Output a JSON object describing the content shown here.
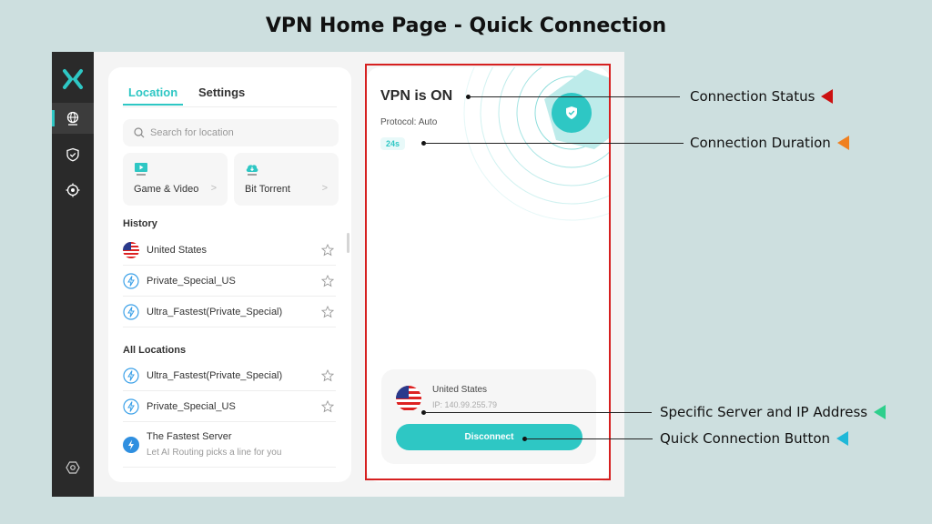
{
  "slide": {
    "title": "VPN Home Page - Quick Connection"
  },
  "rail": {
    "items": [
      {
        "name": "locations",
        "icon": "globe-icon",
        "active": true
      },
      {
        "name": "protection",
        "icon": "shield-check-icon",
        "active": false
      },
      {
        "name": "target",
        "icon": "crosshair-icon",
        "active": false
      },
      {
        "name": "settings",
        "icon": "gear-hexagon-icon",
        "active": false
      }
    ]
  },
  "left": {
    "tabs": [
      {
        "label": "Location",
        "active": true
      },
      {
        "label": "Settings",
        "active": false
      }
    ],
    "search": {
      "placeholder": "Search for location",
      "value": ""
    },
    "quick": [
      {
        "label": "Game & Video",
        "icon": "tv-play-icon"
      },
      {
        "label": "Bit Torrent",
        "icon": "cloud-download-icon"
      }
    ],
    "history": {
      "title": "History",
      "items": [
        {
          "label": "United States",
          "icon": "us-flag-icon"
        },
        {
          "label": "Private_Special_US",
          "icon": "bolt-circle-icon"
        },
        {
          "label": "Ultra_Fastest(Private_Special)",
          "icon": "bolt-circle-icon"
        }
      ]
    },
    "all": {
      "title": "All Locations",
      "items": [
        {
          "label": "Ultra_Fastest(Private_Special)",
          "icon": "bolt-circle-icon"
        },
        {
          "label": "Private_Special_US",
          "icon": "bolt-circle-icon"
        }
      ],
      "fastest": {
        "label": "The Fastest Server",
        "sub": "Let AI Routing picks a line for you"
      }
    }
  },
  "right": {
    "status": "VPN is ON",
    "protocol": "Protocol: Auto",
    "duration": "24s",
    "server": {
      "country": "United States",
      "ip": "IP: 140.99.255.79"
    },
    "disconnect_label": "Disconnect"
  },
  "colors": {
    "accent": "#2ec7c4",
    "highlight": "#d62020"
  },
  "callouts": [
    {
      "label": "Connection Status",
      "color": "#cc1111"
    },
    {
      "label": "Connection Duration",
      "color": "#f08020"
    },
    {
      "label": "Specific Server and IP Address",
      "color": "#2ecf8c"
    },
    {
      "label": "Quick Connection Button",
      "color": "#1fb8d8"
    }
  ]
}
